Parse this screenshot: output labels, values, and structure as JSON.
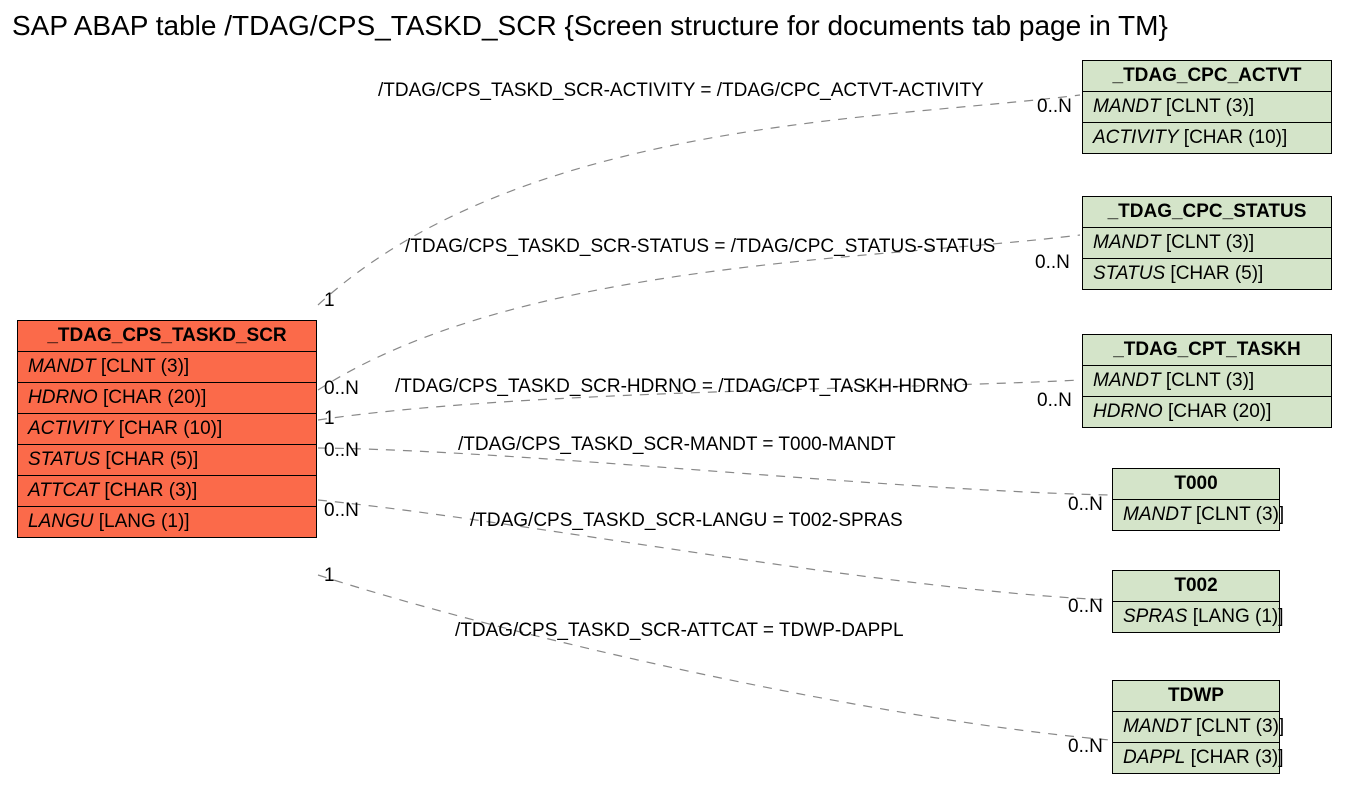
{
  "title": "SAP ABAP table /TDAG/CPS_TASKD_SCR {Screen structure for documents tab page in TM}",
  "main": {
    "name": "_TDAG_CPS_TASKD_SCR",
    "fields": [
      {
        "n": "MANDT",
        "t": "[CLNT (3)]"
      },
      {
        "n": "HDRNO",
        "t": "[CHAR (20)]"
      },
      {
        "n": "ACTIVITY",
        "t": "[CHAR (10)]"
      },
      {
        "n": "STATUS",
        "t": "[CHAR (5)]"
      },
      {
        "n": "ATTCAT",
        "t": "[CHAR (3)]"
      },
      {
        "n": "LANGU",
        "t": "[LANG (1)]"
      }
    ]
  },
  "rels": [
    {
      "label": "/TDAG/CPS_TASKD_SCR-ACTIVITY = /TDAG/CPC_ACTVT-ACTIVITY"
    },
    {
      "label": "/TDAG/CPS_TASKD_SCR-STATUS = /TDAG/CPC_STATUS-STATUS"
    },
    {
      "label": "/TDAG/CPS_TASKD_SCR-HDRNO = /TDAG/CPT_TASKH-HDRNO"
    },
    {
      "label": "/TDAG/CPS_TASKD_SCR-MANDT = T000-MANDT"
    },
    {
      "label": "/TDAG/CPS_TASKD_SCR-LANGU = T002-SPRAS"
    },
    {
      "label": "/TDAG/CPS_TASKD_SCR-ATTCAT = TDWP-DAPPL"
    }
  ],
  "targets": [
    {
      "name": "_TDAG_CPC_ACTVT",
      "fields": [
        {
          "n": "MANDT",
          "t": "[CLNT (3)]"
        },
        {
          "n": "ACTIVITY",
          "t": "[CHAR (10)]"
        }
      ]
    },
    {
      "name": "_TDAG_CPC_STATUS",
      "fields": [
        {
          "n": "MANDT",
          "t": "[CLNT (3)]"
        },
        {
          "n": "STATUS",
          "t": "[CHAR (5)]"
        }
      ]
    },
    {
      "name": "_TDAG_CPT_TASKH",
      "fields": [
        {
          "n": "MANDT",
          "t": "[CLNT (3)]"
        },
        {
          "n": "HDRNO",
          "t": "[CHAR (20)]"
        }
      ]
    },
    {
      "name": "T000",
      "fields": [
        {
          "n": "MANDT",
          "t": "[CLNT (3)]"
        }
      ]
    },
    {
      "name": "T002",
      "fields": [
        {
          "n": "SPRAS",
          "t": "[LANG (1)]"
        }
      ]
    },
    {
      "name": "TDWP",
      "fields": [
        {
          "n": "MANDT",
          "t": "[CLNT (3)]"
        },
        {
          "n": "DAPPL",
          "t": "[CHAR (3)]"
        }
      ]
    }
  ],
  "cards": {
    "left1": "1",
    "left0n": "0..N",
    "right0n": "0..N"
  }
}
